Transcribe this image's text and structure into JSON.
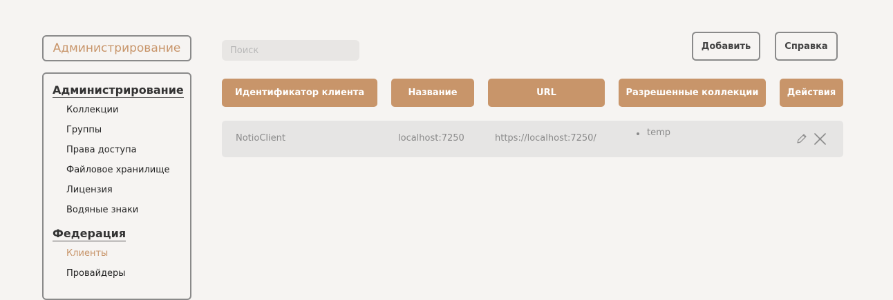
{
  "header": {
    "title": "Администрирование"
  },
  "search": {
    "placeholder": "Поиск"
  },
  "toolbar": {
    "add_label": "Добавить",
    "help_label": "Справка"
  },
  "sidebar": {
    "sections": [
      {
        "title": "Администрирование",
        "items": [
          "Коллекции",
          "Группы",
          "Права доступа",
          "Файловое хранилище",
          "Лицензия",
          "Водяные знаки"
        ]
      },
      {
        "title": "Федерация",
        "items": [
          "Клиенты",
          "Провайдеры"
        ]
      }
    ],
    "active_item": "Клиенты"
  },
  "table": {
    "columns": [
      "Идентификатор клиента",
      "Название",
      "URL",
      "Разрешенные коллекции",
      "Действия"
    ],
    "rows": [
      {
        "client_id": "NotioClient",
        "name": "localhost:7250",
        "url": "https://localhost:7250/",
        "collections": [
          "temp"
        ],
        "actions": [
          "pencil-icon",
          "close-icon"
        ]
      }
    ]
  },
  "colors": {
    "accent": "#c8956a",
    "background": "#f6f4f2",
    "row_bg": "#e6e5e4",
    "border": "#8a8a8a"
  }
}
